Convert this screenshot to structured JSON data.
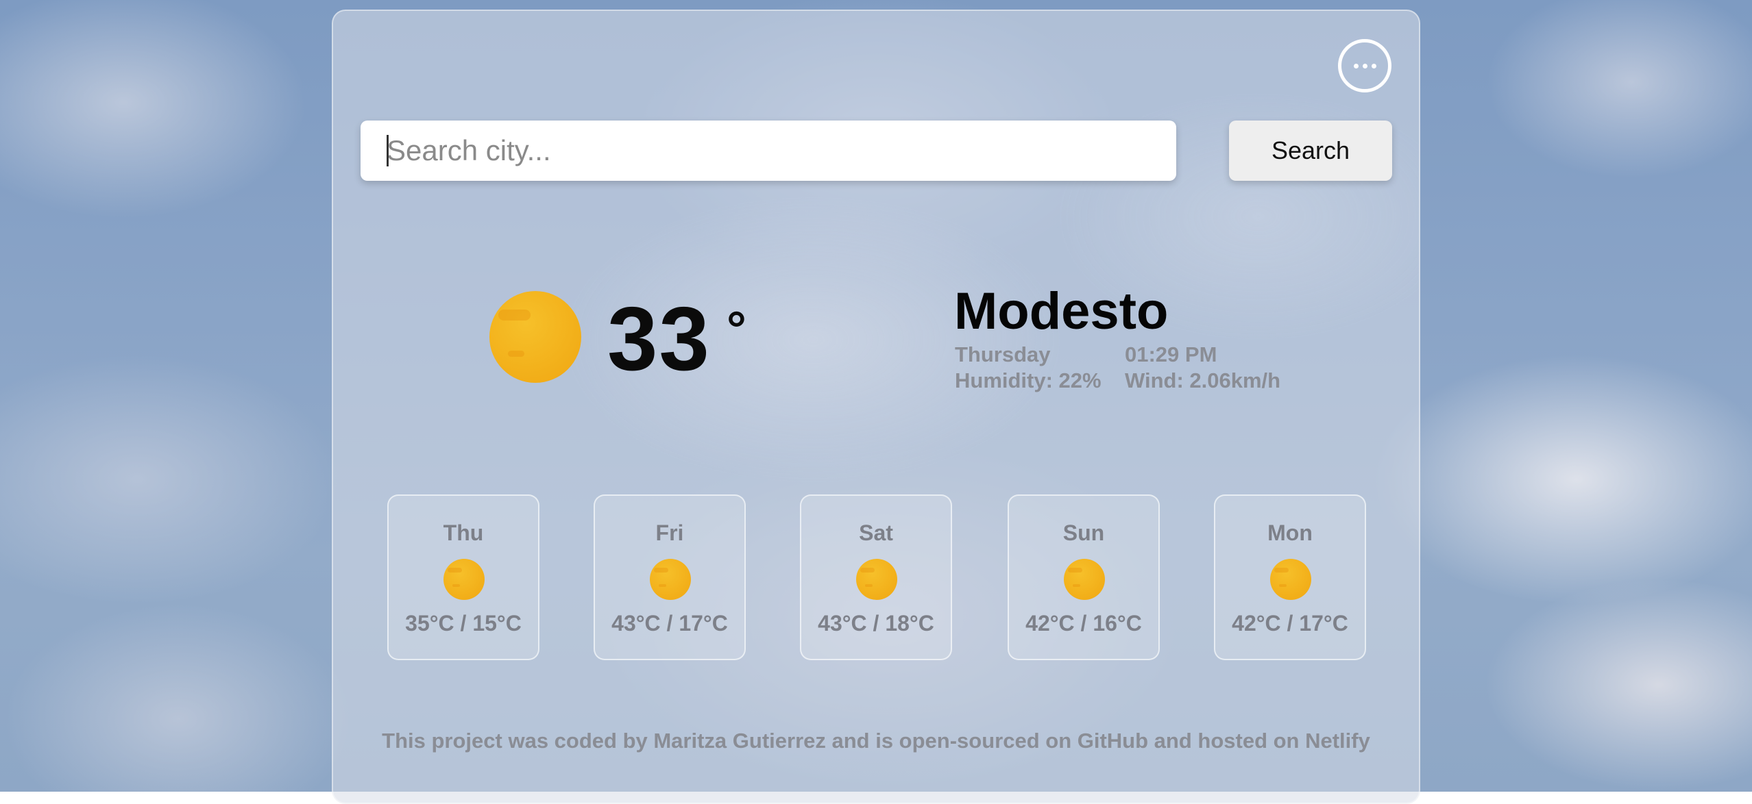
{
  "search": {
    "placeholder": "Search city...",
    "value": "",
    "button_label": "Search"
  },
  "menu": {
    "icon": "more-horizontal-icon"
  },
  "current": {
    "icon": "sun-icon",
    "temperature": "33",
    "degree_symbol": "°",
    "city": "Modesto",
    "day": "Thursday",
    "time": "01:29 PM",
    "humidity": "Humidity: 22%",
    "wind": "Wind: 2.06km/h"
  },
  "forecast": [
    {
      "day": "Thu",
      "icon": "sun-icon",
      "range": "35°C / 15°C"
    },
    {
      "day": "Fri",
      "icon": "sun-icon",
      "range": "43°C / 17°C"
    },
    {
      "day": "Sat",
      "icon": "sun-icon",
      "range": "43°C / 18°C"
    },
    {
      "day": "Sun",
      "icon": "sun-icon",
      "range": "42°C / 16°C"
    },
    {
      "day": "Mon",
      "icon": "sun-icon",
      "range": "42°C / 17°C"
    }
  ],
  "footer": {
    "text": "This project was coded by Maritza Gutierrez and is open-sourced on GitHub and hosted on Netlify"
  },
  "colors": {
    "sun": "#f3b21c",
    "muted_text": "#8a8d95",
    "primary_text": "#0b0b0b"
  }
}
